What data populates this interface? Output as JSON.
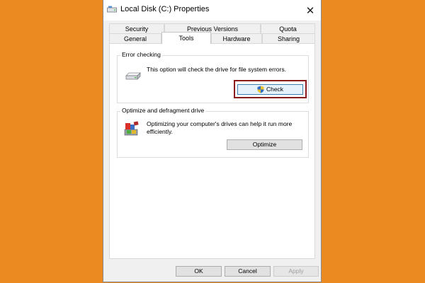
{
  "window": {
    "title": "Local Disk (C:) Properties",
    "close_glyph": "✕"
  },
  "tabs": {
    "row1": [
      "Security",
      "Previous Versions",
      "Quota"
    ],
    "row2": [
      "General",
      "Tools",
      "Hardware",
      "Sharing"
    ],
    "active": "Tools"
  },
  "error_checking": {
    "group_label": "Error checking",
    "description": "This option will check the drive for file system errors.",
    "button_label": "Check",
    "icon": "drive-icon",
    "button_icon": "uac-shield-icon",
    "highlight_color": "#8b1a1a"
  },
  "optimize": {
    "group_label": "Optimize and defragment drive",
    "description": "Optimizing your computer's drives can help it run more efficiently.",
    "button_label": "Optimize",
    "icon": "defrag-icon"
  },
  "footer": {
    "ok_label": "OK",
    "cancel_label": "Cancel",
    "apply_label": "Apply"
  },
  "colors": {
    "background": "#ec8a22",
    "dialog": "#f0f0f0"
  }
}
